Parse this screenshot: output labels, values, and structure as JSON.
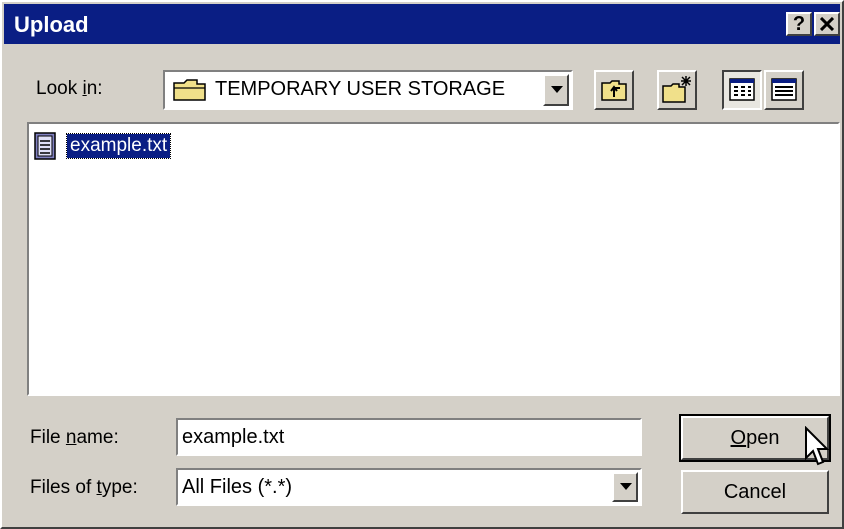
{
  "window": {
    "title": "Upload",
    "help_label": "?",
    "close_label": "✕"
  },
  "look_in": {
    "label": "Look in:",
    "value": "TEMPORARY USER STORAGE",
    "icon": "folder-icon"
  },
  "toolbar": {
    "up_folder_icon": "up-folder-icon",
    "new_folder_icon": "new-folder-icon",
    "list_view_icon": "list-view-icon",
    "details_view_icon": "details-view-icon"
  },
  "files": [
    {
      "name": "example.txt",
      "icon": "text-file-icon",
      "selected": true
    }
  ],
  "file_name": {
    "label": "File name:",
    "value": "example.txt"
  },
  "file_type": {
    "label": "Files of type:",
    "value": "All Files (*.*)"
  },
  "buttons": {
    "open": "Open",
    "cancel": "Cancel"
  },
  "colors": {
    "titlebar": "#0a1e84",
    "face": "#d4d0c8",
    "selection": "#0a1e84"
  }
}
